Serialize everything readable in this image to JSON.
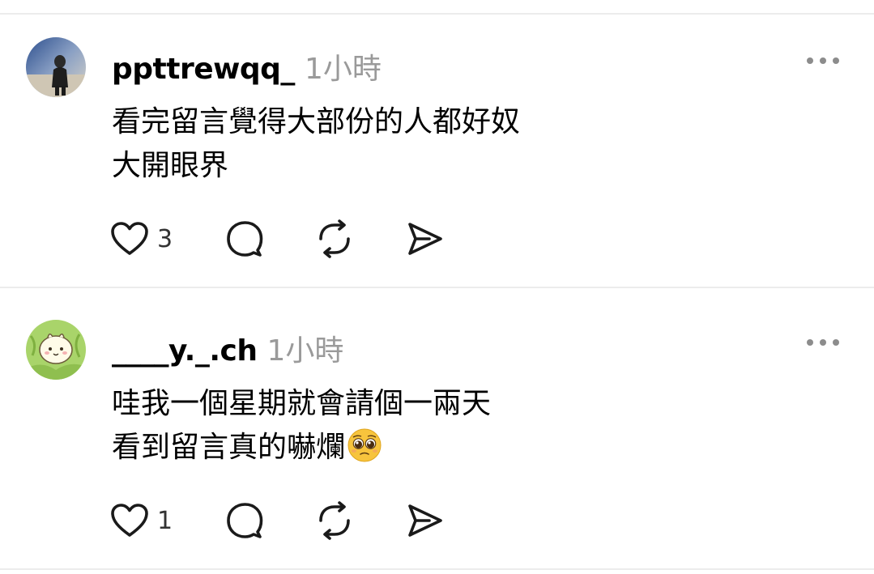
{
  "posts": [
    {
      "username": "ppttrewqq_",
      "time": "1小時",
      "lines": [
        "看完留言覺得大部份的人都好奴",
        "大開眼界"
      ],
      "likes": "3",
      "avatar_icon": "person-photo-avatar"
    },
    {
      "username": "____y._.ch",
      "time": "1小時",
      "lines": [
        "哇我一個星期就會請個一兩天",
        "看到留言真的嚇爛"
      ],
      "emoji": "pleading-face-emoji",
      "likes": "1",
      "avatar_icon": "cartoon-character-avatar"
    }
  ],
  "colors": {
    "divider": "#ececec",
    "muted": "#9a9a9a",
    "icon": "#1a1a1a",
    "avatar2_bg": "#a9d46a"
  }
}
